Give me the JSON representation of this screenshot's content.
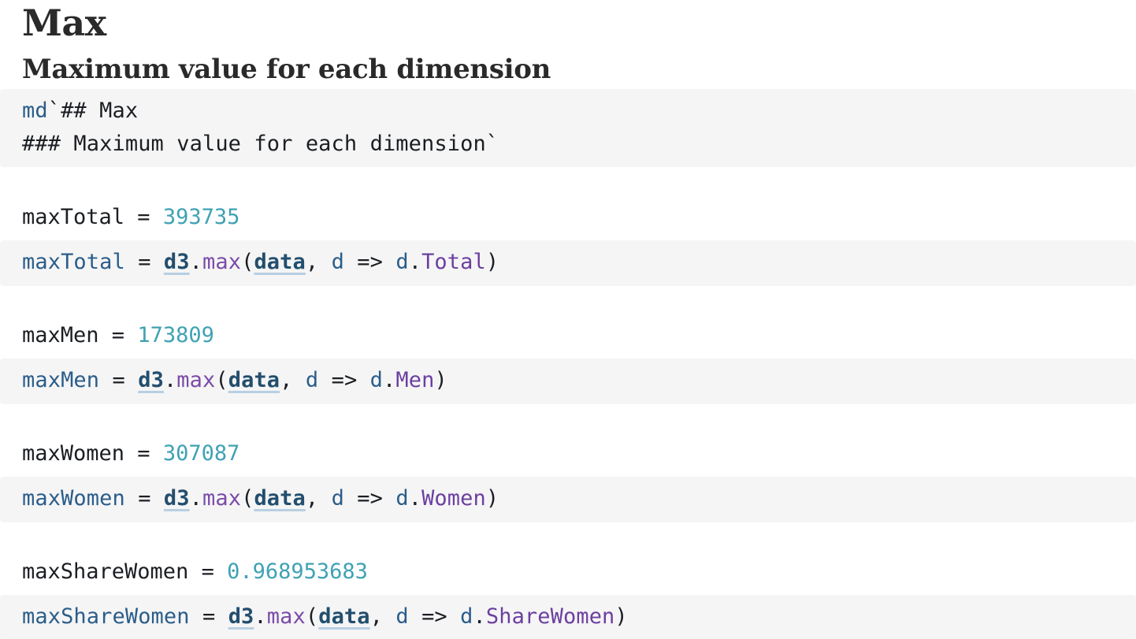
{
  "markdown_cell": {
    "rendered_title": "Max",
    "rendered_subtitle": "Maximum value for each dimension",
    "source": {
      "tag": "md",
      "line1_rest": "`## Max",
      "line2": "### Maximum value for each dimension`"
    }
  },
  "cells": [
    {
      "name": "maxTotal",
      "value": "393735",
      "source": {
        "lib": "d3",
        "fn": "max",
        "arg": "data",
        "param": "d",
        "prop": "Total"
      }
    },
    {
      "name": "maxMen",
      "value": "173809",
      "source": {
        "lib": "d3",
        "fn": "max",
        "arg": "data",
        "param": "d",
        "prop": "Men"
      }
    },
    {
      "name": "maxWomen",
      "value": "307087",
      "source": {
        "lib": "d3",
        "fn": "max",
        "arg": "data",
        "param": "d",
        "prop": "Women"
      }
    },
    {
      "name": "maxShareWomen",
      "value": "0.968953683",
      "source": {
        "lib": "d3",
        "fn": "max",
        "arg": "data",
        "param": "d",
        "prop": "ShareWomen"
      }
    }
  ],
  "syntax": {
    "equals": " = ",
    "dot": ".",
    "open_paren": "(",
    "comma": ", ",
    "arrow": " => ",
    "close_paren": ")"
  },
  "colors": {
    "code_background": "#f5f5f5",
    "number": "#3fa2b3",
    "function": "#7a4ba8",
    "reference": "#234e6e",
    "variable": "#2a5d8a"
  }
}
